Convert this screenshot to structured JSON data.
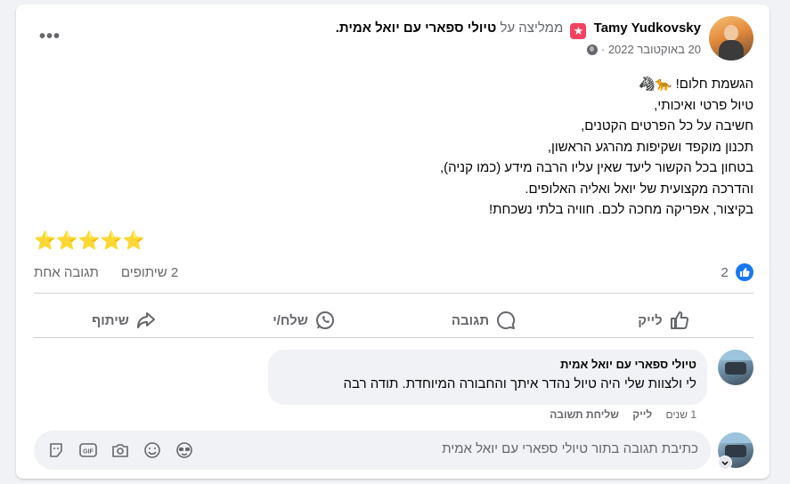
{
  "post": {
    "author_name": "Tamy Yudkovsky",
    "recommends_text": "ממליצה על",
    "page_name": "טיולי ספארי עם יואל אמית",
    "date": "20 באוקטובר 2022",
    "date_separator": "·",
    "audience_icon": "globe-icon",
    "more_label": "•••",
    "lines": [
      "הגשמת חלום! 🐆🦓",
      "טיול פרטי ואיכותי,",
      "חשיבה על כל הפרטים הקטנים,",
      "תכנון מוקפד ושקיפות מהרגע הראשון,",
      "בטחון בכל הקשור ליעד שאין עליו הרבה מידע (כמו קניה),",
      "והדרכה מקצועית של יואל ואליה האלופים.",
      "בקיצור, אפריקה מחכה לכם. חוויה בלתי נשכחת!"
    ],
    "stars": "⭐⭐⭐⭐⭐",
    "like_count": "2",
    "comment_count": "תגובה אחת",
    "share_count": "2 שיתופים"
  },
  "actions": {
    "like": "לייק",
    "comment": "תגובה",
    "send": "שלח/י",
    "share": "שיתוף"
  },
  "comment": {
    "author": "טיולי ספארי עם יואל אמית",
    "text": "לי ולצוות שלי היה טיול נהדר איתך והחבורה המיוחדת. תודה רבה",
    "time": "1 שנים",
    "like": "לייק",
    "reply": "שליחת תשובה"
  },
  "reply_box": {
    "placeholder": "כתיבת תגובה בתור טיולי ספארי עם יואל אמית"
  },
  "colors": {
    "accent": "#1877f2",
    "badge": "#f3425f",
    "muted": "#65676b",
    "star": "#f7b928"
  }
}
